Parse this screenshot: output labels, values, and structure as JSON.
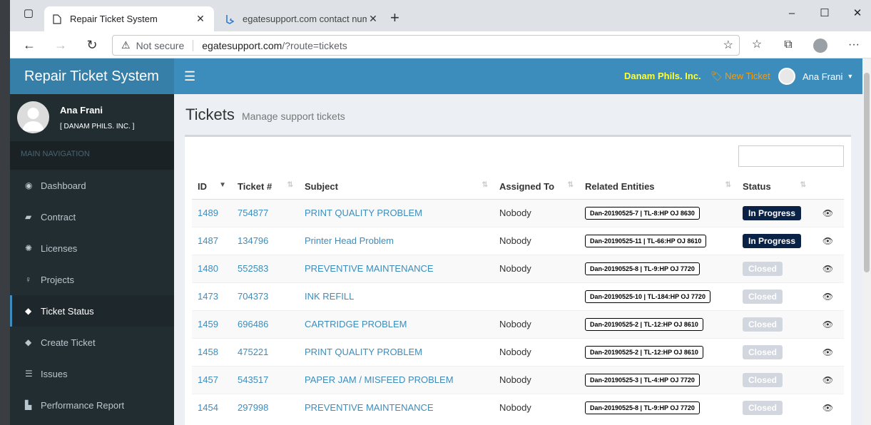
{
  "browser": {
    "tabs": [
      {
        "label": "Repair Ticket System",
        "active": true
      },
      {
        "label": "egatesupport.com contact numb",
        "active": false
      }
    ],
    "security": "Not secure",
    "url_host": "egatesupport.com",
    "url_path": "/?route=tickets"
  },
  "app": {
    "brand": "Repair Ticket System",
    "company": "Danam Phils. Inc.",
    "new_ticket": "New Ticket",
    "user_name": "Ana Frani"
  },
  "sidebar": {
    "user_name": "Ana Frani",
    "user_org": "[ DANAM PHILS. INC. ]",
    "nav_header": "MAIN NAVIGATION",
    "items": [
      {
        "label": "Dashboard",
        "icon": "dashboard-icon"
      },
      {
        "label": "Contract",
        "icon": "book-icon"
      },
      {
        "label": "Licenses",
        "icon": "gear-icon"
      },
      {
        "label": "Projects",
        "icon": "lightbulb-icon"
      },
      {
        "label": "Ticket Status",
        "icon": "tag-icon",
        "active": true
      },
      {
        "label": "Create Ticket",
        "icon": "tag-icon"
      },
      {
        "label": "Issues",
        "icon": "list-icon"
      },
      {
        "label": "Performance Report",
        "icon": "bar-chart-icon"
      }
    ]
  },
  "page": {
    "title": "Tickets",
    "subtitle": "Manage support tickets"
  },
  "table": {
    "headers": [
      "ID",
      "Ticket #",
      "Subject",
      "Assigned To",
      "Related Entities",
      "Status"
    ],
    "rows": [
      {
        "id": "1489",
        "ticket": "754877",
        "subject": "PRINT QUALITY PROBLEM",
        "assigned": "Nobody",
        "entity": "Dan-20190525-7 | TL-8:HP OJ 8630",
        "status": "In Progress"
      },
      {
        "id": "1487",
        "ticket": "134796",
        "subject": "Printer Head Problem",
        "assigned": "Nobody",
        "entity": "Dan-20190525-11 | TL-66:HP OJ 8610",
        "status": "In Progress"
      },
      {
        "id": "1480",
        "ticket": "552583",
        "subject": "PREVENTIVE MAINTENANCE",
        "assigned": "Nobody",
        "entity": "Dan-20190525-8 | TL-9:HP OJ 7720",
        "status": "Closed"
      },
      {
        "id": "1473",
        "ticket": "704373",
        "subject": "INK REFILL",
        "assigned": "",
        "entity": "Dan-20190525-10 | TL-184:HP OJ 7720",
        "status": "Closed"
      },
      {
        "id": "1459",
        "ticket": "696486",
        "subject": "CARTRIDGE PROBLEM",
        "assigned": "Nobody",
        "entity": "Dan-20190525-2 | TL-12:HP OJ 8610",
        "status": "Closed"
      },
      {
        "id": "1458",
        "ticket": "475221",
        "subject": "PRINT QUALITY PROBLEM",
        "assigned": "Nobody",
        "entity": "Dan-20190525-2 | TL-12:HP OJ 8610",
        "status": "Closed"
      },
      {
        "id": "1457",
        "ticket": "543517",
        "subject": "PAPER JAM / MISFEED PROBLEM",
        "assigned": "Nobody",
        "entity": "Dan-20190525-3 | TL-4:HP OJ 7720",
        "status": "Closed"
      },
      {
        "id": "1454",
        "ticket": "297998",
        "subject": "PREVENTIVE MAINTENANCE",
        "assigned": "Nobody",
        "entity": "Dan-20190525-8 | TL-9:HP OJ 7720",
        "status": "Closed"
      }
    ]
  },
  "colors": {
    "header": "#3c8dbc",
    "logo": "#367fa9",
    "sidebar": "#222d32",
    "status_in_progress": "#0a2245",
    "status_closed": "#d2d6de",
    "company": "#ffff33",
    "new_ticket": "#f39c12"
  }
}
